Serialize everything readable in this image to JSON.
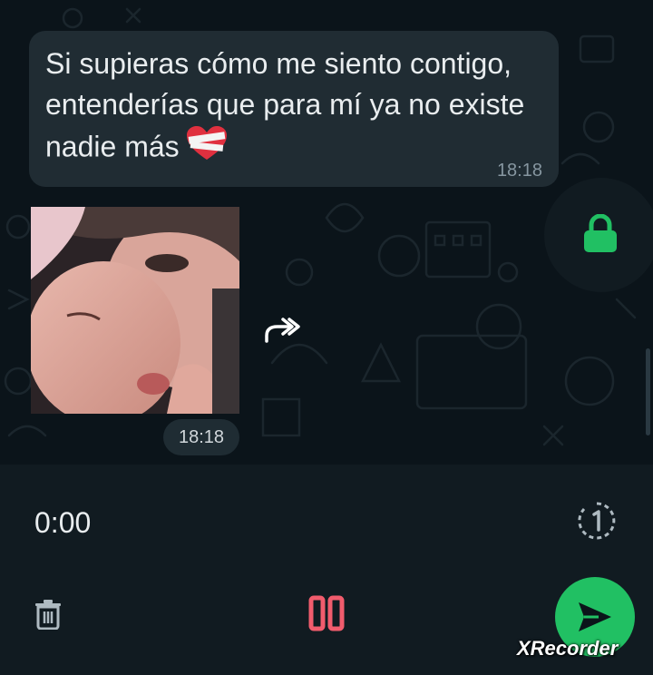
{
  "message": {
    "text": "Si supieras cómo me siento contigo, entenderías que para mí ya no existe nadie más",
    "emoji": "mending-heart",
    "time": "18:18"
  },
  "media": {
    "time": "18:18"
  },
  "icons": {
    "lock": "lock-icon",
    "forward": "forward-icon",
    "view_once": "view-once-icon",
    "delete": "trash-icon",
    "pause": "pause-icon",
    "send": "send-icon"
  },
  "recorder": {
    "timer": "0:00"
  },
  "watermark": "XRecorder",
  "colors": {
    "background": "#0b141a",
    "bubble": "#202c33",
    "panel": "#111b21",
    "accent_green": "#21c063",
    "pause_red": "#f15c6d"
  }
}
